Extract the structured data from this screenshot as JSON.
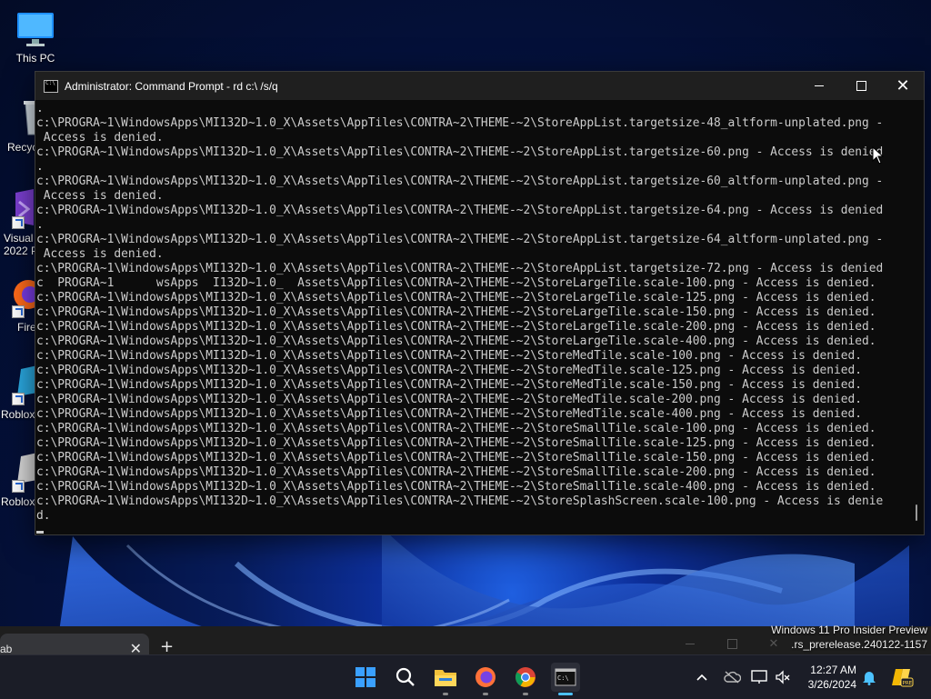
{
  "desktop": {
    "icons": [
      {
        "label": "This PC"
      },
      {
        "label": "Recyc"
      },
      {
        "label": "Visual\n2022 P"
      },
      {
        "label": "Firef"
      },
      {
        "label": "Roblox"
      },
      {
        "label": "Roblox"
      }
    ]
  },
  "cmd": {
    "title": "Administrator: Command Prompt - rd  c:\\ /s/q",
    "lines": [
      ".",
      "c:\\PROGRA~1\\WindowsApps\\MI132D~1.0_X\\Assets\\AppTiles\\CONTRA~2\\THEME-~2\\StoreAppList.targetsize-48_altform-unplated.png -",
      " Access is denied.",
      "c:\\PROGRA~1\\WindowsApps\\MI132D~1.0_X\\Assets\\AppTiles\\CONTRA~2\\THEME-~2\\StoreAppList.targetsize-60.png - Access is denied",
      ".",
      "c:\\PROGRA~1\\WindowsApps\\MI132D~1.0_X\\Assets\\AppTiles\\CONTRA~2\\THEME-~2\\StoreAppList.targetsize-60_altform-unplated.png -",
      " Access is denied.",
      "c:\\PROGRA~1\\WindowsApps\\MI132D~1.0_X\\Assets\\AppTiles\\CONTRA~2\\THEME-~2\\StoreAppList.targetsize-64.png - Access is denied",
      ".",
      "c:\\PROGRA~1\\WindowsApps\\MI132D~1.0_X\\Assets\\AppTiles\\CONTRA~2\\THEME-~2\\StoreAppList.targetsize-64_altform-unplated.png -",
      " Access is denied.",
      "c:\\PROGRA~1\\WindowsApps\\MI132D~1.0_X\\Assets\\AppTiles\\CONTRA~2\\THEME-~2\\StoreAppList.targetsize-72.png - Access is denied",
      "c  PROGRA~1      wsApps  I132D~1.0_  Assets\\AppTiles\\CONTRA~2\\THEME-~2\\StoreLargeTile.scale-100.png - Access is denied.",
      "c:\\PROGRA~1\\WindowsApps\\MI132D~1.0_X\\Assets\\AppTiles\\CONTRA~2\\THEME-~2\\StoreLargeTile.scale-125.png - Access is denied.",
      "c:\\PROGRA~1\\WindowsApps\\MI132D~1.0_X\\Assets\\AppTiles\\CONTRA~2\\THEME-~2\\StoreLargeTile.scale-150.png - Access is denied.",
      "c:\\PROGRA~1\\WindowsApps\\MI132D~1.0_X\\Assets\\AppTiles\\CONTRA~2\\THEME-~2\\StoreLargeTile.scale-200.png - Access is denied.",
      "c:\\PROGRA~1\\WindowsApps\\MI132D~1.0_X\\Assets\\AppTiles\\CONTRA~2\\THEME-~2\\StoreLargeTile.scale-400.png - Access is denied.",
      "c:\\PROGRA~1\\WindowsApps\\MI132D~1.0_X\\Assets\\AppTiles\\CONTRA~2\\THEME-~2\\StoreMedTile.scale-100.png - Access is denied.",
      "c:\\PROGRA~1\\WindowsApps\\MI132D~1.0_X\\Assets\\AppTiles\\CONTRA~2\\THEME-~2\\StoreMedTile.scale-125.png - Access is denied.",
      "c:\\PROGRA~1\\WindowsApps\\MI132D~1.0_X\\Assets\\AppTiles\\CONTRA~2\\THEME-~2\\StoreMedTile.scale-150.png - Access is denied.",
      "c:\\PROGRA~1\\WindowsApps\\MI132D~1.0_X\\Assets\\AppTiles\\CONTRA~2\\THEME-~2\\StoreMedTile.scale-200.png - Access is denied.",
      "c:\\PROGRA~1\\WindowsApps\\MI132D~1.0_X\\Assets\\AppTiles\\CONTRA~2\\THEME-~2\\StoreMedTile.scale-400.png - Access is denied.",
      "c:\\PROGRA~1\\WindowsApps\\MI132D~1.0_X\\Assets\\AppTiles\\CONTRA~2\\THEME-~2\\StoreSmallTile.scale-100.png - Access is denied.",
      "c:\\PROGRA~1\\WindowsApps\\MI132D~1.0_X\\Assets\\AppTiles\\CONTRA~2\\THEME-~2\\StoreSmallTile.scale-125.png - Access is denied.",
      "c:\\PROGRA~1\\WindowsApps\\MI132D~1.0_X\\Assets\\AppTiles\\CONTRA~2\\THEME-~2\\StoreSmallTile.scale-150.png - Access is denied.",
      "c:\\PROGRA~1\\WindowsApps\\MI132D~1.0_X\\Assets\\AppTiles\\CONTRA~2\\THEME-~2\\StoreSmallTile.scale-200.png - Access is denied.",
      "c:\\PROGRA~1\\WindowsApps\\MI132D~1.0_X\\Assets\\AppTiles\\CONTRA~2\\THEME-~2\\StoreSmallTile.scale-400.png - Access is denied.",
      "c:\\PROGRA~1\\WindowsApps\\MI132D~1.0_X\\Assets\\AppTiles\\CONTRA~2\\THEME-~2\\StoreSplashScreen.scale-100.png - Access is denie",
      "d."
    ]
  },
  "browser": {
    "tab_label": "ab",
    "tab_close": "✕",
    "new_tab": "+",
    "ctrl_close": "✕"
  },
  "watermark": {
    "line1": "Windows 11 Pro Insider Preview",
    "line2": ".rs_prerelease.240122-1157"
  },
  "taskbar": {
    "apps": [
      "start-icon",
      "search-icon",
      "file-explorer-icon",
      "firefox-icon",
      "chrome-icon",
      "terminal-icon"
    ],
    "accent": "#4cc2ff"
  },
  "clock": {
    "time": "12:27 AM",
    "date": "3/26/2024"
  },
  "colors": {
    "cmd_bg": "#0c0c0c",
    "cmd_text": "#cccccc",
    "titlebar": "#1f1f1f"
  }
}
